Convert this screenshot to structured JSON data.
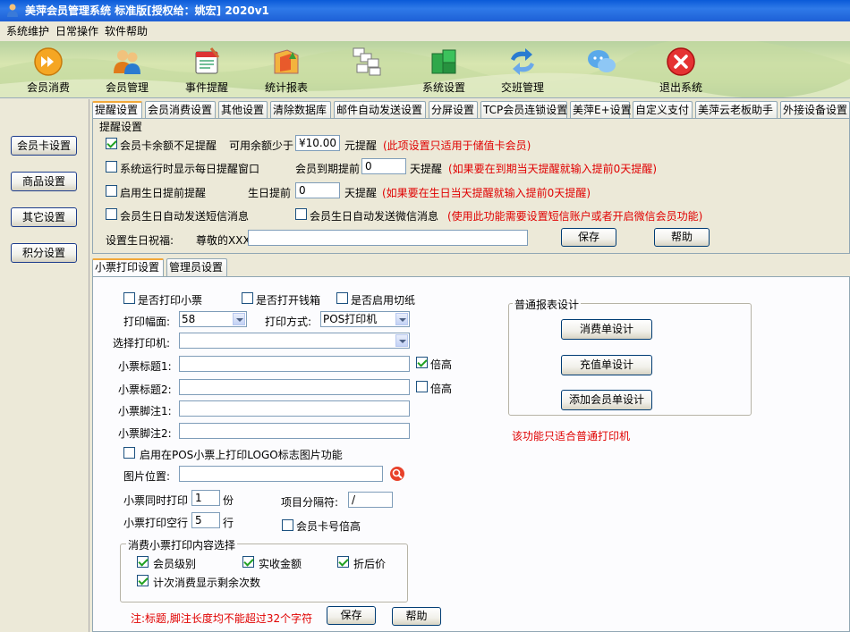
{
  "window": {
    "title": "美萍会员管理系统 标准版[授权给：姚宏]  2020v1"
  },
  "menu": [
    "系统维护",
    "日常操作",
    "软件帮助"
  ],
  "toolbar": [
    {
      "label": "会员消费",
      "icon": "forward-icon"
    },
    {
      "label": "会员管理",
      "icon": "members-icon"
    },
    {
      "label": "事件提醒",
      "icon": "calendar-icon"
    },
    {
      "label": "统计报表",
      "icon": "report-icon"
    },
    {
      "label": "",
      "icon": "documents-icon"
    },
    {
      "label": "系统设置",
      "icon": "settings-icon"
    },
    {
      "label": "交班管理",
      "icon": "shift-icon"
    },
    {
      "label": "",
      "icon": "chat-icon"
    },
    {
      "label": "退出系统",
      "icon": "exit-icon"
    }
  ],
  "sidebar": [
    "会员卡设置",
    "商品设置",
    "其它设置",
    "积分设置"
  ],
  "top_tabs": [
    "提醒设置",
    "会员消费设置",
    "其他设置",
    "清除数据库",
    "邮件自动发送设置",
    "分屏设置",
    "TCP会员连锁设置",
    "美萍E+设置",
    "自定义支付",
    "美萍云老板助手",
    "外接设备设置"
  ],
  "reminder": {
    "group_title": "提醒设置",
    "balance_label": "会员卡余额不足提醒",
    "balance_checked": true,
    "min_balance_label": "可用余额少于",
    "min_balance_value": "¥10.00",
    "yuan_remind": "元提醒",
    "balance_note": "(此项设置只适用于储值卡会员)",
    "daily_popup_label": "系统运行时显示每日提醒窗口",
    "daily_popup_checked": false,
    "expire_label": "会员到期提前",
    "expire_value": "0",
    "days_remind": "天提醒",
    "expire_note": "(如果要在到期当天提醒就输入提前0天提醒)",
    "birthday_label": "启用生日提前提醒",
    "birthday_checked": false,
    "birthday_advance_label": "生日提前",
    "birthday_value": "0",
    "birthday_days_remind": "天提醒",
    "birthday_note": "(如果要在生日当天提醒就输入提前0天提醒)",
    "sms_label": "会员生日自动发送短信消息",
    "sms_checked": false,
    "wechat_label": "会员生日自动发送微信消息",
    "wechat_checked": false,
    "wechat_note": "(使用此功能需要设置短信账户或者开启微信会员功能)",
    "greeting_label": "设置生日祝福:",
    "greeting_prefix": "尊敬的XXX",
    "greeting_value": "",
    "save": "保存",
    "help": "帮助"
  },
  "bottom_tabs": [
    "小票打印设置",
    "管理员设置"
  ],
  "print": {
    "print_receipt_label": "是否打印小票",
    "print_receipt_checked": false,
    "open_drawer_label": "是否打开钱箱",
    "open_drawer_checked": false,
    "cutter_label": "是否启用切纸",
    "cutter_checked": false,
    "width_label": "打印幅面:",
    "width_value": "58",
    "mode_label": "打印方式:",
    "mode_value": "POS打印机",
    "printer_label": "选择打印机:",
    "printer_value": "",
    "title1_label": "小票标题1:",
    "title1_value": "",
    "title1_double": true,
    "title2_label": "小票标题2:",
    "title2_value": "",
    "title2_double": false,
    "double_label": "倍高",
    "footer1_label": "小票脚注1:",
    "footer1_value": "",
    "footer2_label": "小票脚注2:",
    "footer2_value": "",
    "logo_label": "启用在POS小票上打印LOGO标志图片功能",
    "logo_checked": false,
    "image_label": "图片位置:",
    "image_value": "",
    "copies_label": "小票同时打印",
    "copies_value": "1",
    "copies_unit": "份",
    "separator_label": "项目分隔符:",
    "separator_value": "/",
    "blank_label": "小票打印空行",
    "blank_value": "5",
    "blank_unit": "行",
    "cardno_label": "会员卡号倍高",
    "cardno_checked": false,
    "content_title": "消费小票打印内容选择",
    "content": [
      {
        "label": "会员级别",
        "checked": true
      },
      {
        "label": "实收金额",
        "checked": true
      },
      {
        "label": "折后价",
        "checked": true
      },
      {
        "label": "计次消费显示剩余次数",
        "checked": true
      }
    ],
    "note": "注:标题,脚注长度均不能超过32个字符",
    "save": "保存",
    "help": "帮助"
  },
  "report_design": {
    "title": "普通报表设计",
    "buttons": [
      "消费单设计",
      "充值单设计",
      "添加会员单设计"
    ],
    "note": "该功能只适合普通打印机"
  },
  "colors": {
    "titlebar": "#1d5fd6",
    "note_red": "#e00000",
    "tab_accent": "#f2a83a",
    "panel_bg": "#fcfcfe",
    "window_bg": "#ece9d8"
  }
}
